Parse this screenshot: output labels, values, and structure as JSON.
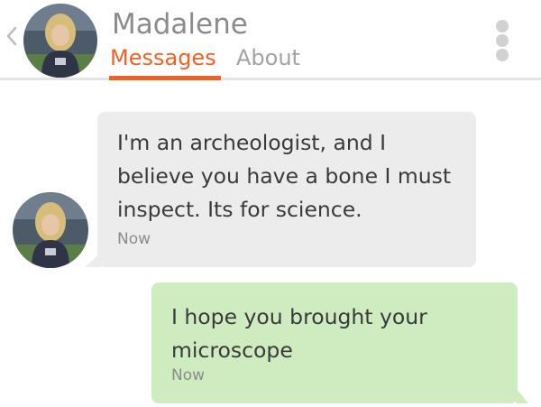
{
  "header": {
    "contact_name": "Madalene",
    "tabs": [
      {
        "label": "Messages",
        "active": true
      },
      {
        "label": "About",
        "active": false
      }
    ]
  },
  "conversation": {
    "messages": [
      {
        "direction": "incoming",
        "text": "I'm an archeologist, and I believe you have a bone I must inspect. Its for science.",
        "timestamp": "Now"
      },
      {
        "direction": "outgoing",
        "text": "I hope you brought your microscope",
        "timestamp": "Now"
      }
    ]
  },
  "colors": {
    "accent": "#e8642a",
    "incoming_bubble": "#ececec",
    "outgoing_bubble": "#cfebc0",
    "name_text": "#8b8b8b",
    "inactive_tab": "#a3a3a3",
    "message_text": "#3a3a3a",
    "timestamp_text": "#8c8c8c"
  },
  "icons": {
    "back": "chevron-left-icon",
    "more": "more-vertical-icon"
  }
}
